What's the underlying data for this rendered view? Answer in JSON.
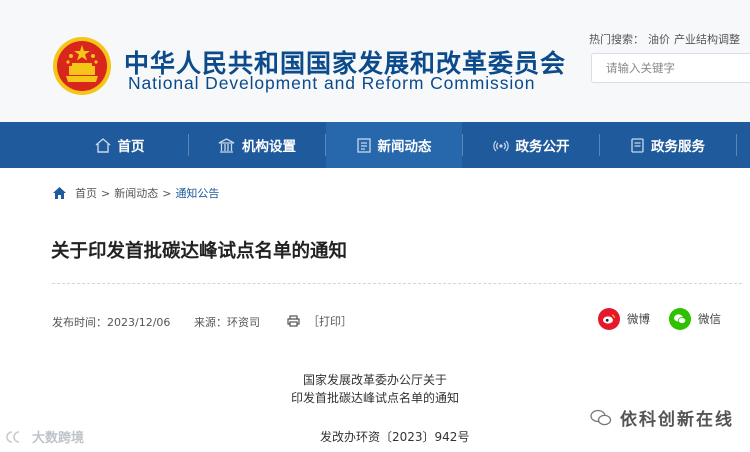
{
  "header": {
    "title_cn": "中华人民共和国国家发展和改革委员会",
    "title_en": "National Development and Reform Commission",
    "hot_search_label": "热门搜索：",
    "hot_search_terms": [
      "油价",
      "产业结构调整"
    ],
    "search_placeholder": "请输入关键字"
  },
  "nav": {
    "items": [
      {
        "label": "首页",
        "icon": "home-icon"
      },
      {
        "label": "机构设置",
        "icon": "building-icon"
      },
      {
        "label": "新闻动态",
        "icon": "news-icon"
      },
      {
        "label": "政务公开",
        "icon": "broadcast-icon"
      },
      {
        "label": "政务服务",
        "icon": "document-icon"
      }
    ],
    "active_index": 2
  },
  "breadcrumb": {
    "items": [
      "首页",
      "新闻动态",
      "通知公告"
    ],
    "separator": ">"
  },
  "article": {
    "title": "关于印发首批碳达峰试点名单的通知",
    "publish_date": "发布时间：2023/12/06",
    "source": "来源：环资司",
    "print_label": "［打印］",
    "share": [
      {
        "label": "微博",
        "icon": "weibo-icon",
        "color": "#e6162d"
      },
      {
        "label": "微信",
        "icon": "wechat-icon",
        "color": "#2dc100"
      }
    ],
    "body_lines": [
      "国家发展改革委办公厅关于",
      "印发首批碳达峰试点名单的通知"
    ],
    "doc_number": "发改办环资〔2023〕942号"
  },
  "watermarks": {
    "left": "大数跨境",
    "right": "依科创新在线"
  },
  "colors": {
    "brand_blue": "#0b4a8b",
    "nav_bg": "#1e5a9c",
    "nav_active": "#2768ad",
    "emblem_red": "#d9261c",
    "emblem_gold": "#f5c518"
  }
}
